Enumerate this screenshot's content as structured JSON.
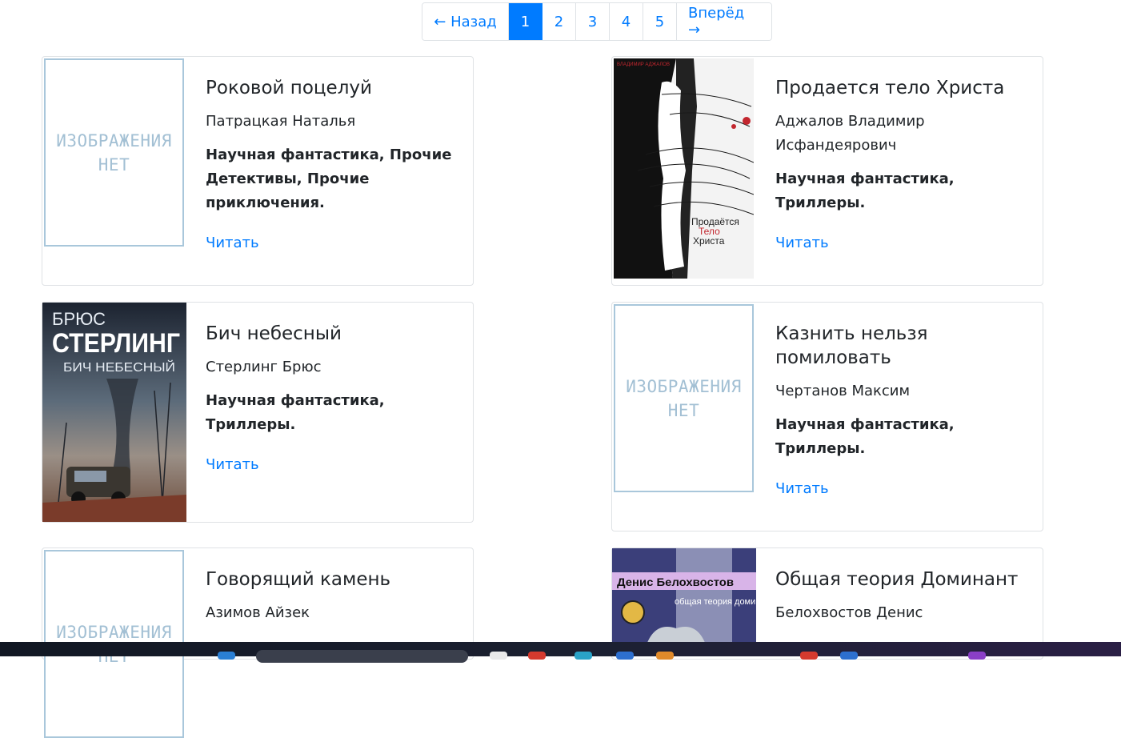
{
  "pagination": {
    "prev": "← Назад",
    "pages": [
      "1",
      "2",
      "3",
      "4",
      "5"
    ],
    "active": "1",
    "next": "Вперёд →"
  },
  "books": [
    {
      "title": "Роковой поцелуй",
      "author": "Патрацкая Наталья",
      "genres": "Научная фантастика, Прочие Детективы, Прочие приключения.",
      "read": "Читать",
      "placeholder": "ИЗОБРАЖЕНИЯ НЕТ"
    },
    {
      "title": "Продается тело Христа",
      "author": "Аджалов Владимир Исфандеярович",
      "genres": "Научная фантастика, Триллеры.",
      "read": "Читать",
      "cover_author": "ВЛАДИМИР АДЖАЛОВ",
      "cover_title_1": "Продаётся",
      "cover_title_2": "Тело",
      "cover_title_3": "Христа"
    },
    {
      "title": "Бич небесный",
      "author": "Стерлинг Брюс",
      "genres": "Научная фантастика, Триллеры.",
      "read": "Читать",
      "cover_line_1": "БРЮС",
      "cover_line_2": "СТЕРЛИНГ",
      "cover_line_3": "БИЧ НЕБЕСНЫЙ"
    },
    {
      "title": "Казнить нельзя помиловать",
      "author": "Чертанов Максим",
      "genres": "Научная фантастика, Триллеры.",
      "read": "Читать",
      "placeholder": "ИЗОБРАЖЕНИЯ НЕТ"
    },
    {
      "title": "Говорящий камень",
      "author": "Азимов Айзек",
      "placeholder": "ИЗОБРАЖЕНИЯ НЕТ"
    },
    {
      "title": "Общая теория Доминант",
      "author": "Белохвостов Денис",
      "cover_author": "Денис Белохвостов",
      "cover_title": "общая теория доминант"
    }
  ],
  "colors": {
    "link": "#007bff",
    "placeholder_text": "#a3c0d4",
    "border": "#dfe2e5"
  }
}
